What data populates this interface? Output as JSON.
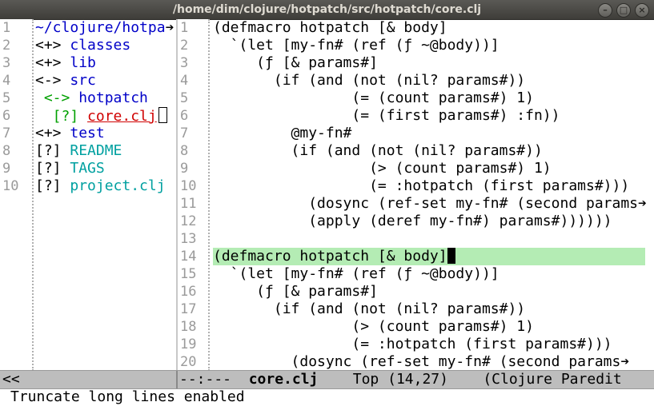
{
  "window": {
    "title": "/home/dim/clojure/hotpatch/src/hotpatch/core.clj",
    "buttons": [
      "–",
      "□",
      "×"
    ]
  },
  "tree_pane": {
    "line_numbers": [
      "1",
      "2",
      "3",
      "4",
      "5",
      "6",
      "7",
      "8",
      "9",
      "10"
    ],
    "lines": [
      {
        "text": "~/clojure/hotpa",
        "color": "#0000c8"
      },
      {
        "text": "<+> classes",
        "color": "#0000c8"
      },
      {
        "text": "<+> lib",
        "color": "#0000c8"
      },
      {
        "text": "<-> src",
        "color": "#0000c8"
      },
      {
        "text": " <-> hotpatch",
        "color": "#0000c8"
      },
      {
        "text": "  [?] core.clj",
        "color": "#d00000"
      },
      {
        "text": "<+> test",
        "color": "#0000c8"
      },
      {
        "text": "[?] README",
        "color": "#00a0a0"
      },
      {
        "text": "[?] TAGS",
        "color": "#00a0a0"
      },
      {
        "text": "[?] project.clj",
        "color": "#00a0a0"
      }
    ],
    "truncation_mark": "➔"
  },
  "code_pane": {
    "line_numbers": [
      "1",
      "2",
      "3",
      "4",
      "5",
      "6",
      "7",
      "8",
      "9",
      "10",
      "11",
      "12",
      "13",
      "14",
      "15",
      "16",
      "17",
      "18",
      "19",
      "20"
    ],
    "lines": [
      "(defmacro hotpatch [& body]",
      "  `(let [my-fn# (ref (ƒ ~@body))]",
      "     (ƒ [& params#]",
      "       (if (and (not (nil? params#))",
      "                (= (count params#) 1)",
      "                (= (first params#) :fn))",
      "         @my-fn#",
      "         (if (and (not (nil? params#))",
      "                  (> (count params#) 1)",
      "                  (= :hotpatch (first params#)))",
      "           (dosync (ref-set my-fn# (second params",
      "           (apply (deref my-fn#) params#))))))",
      "",
      "(defmacro hotpatch [& body]",
      "  `(let [my-fn# (ref (ƒ ~@body))]",
      "     (ƒ [& params#]",
      "       (if (and (not (nil? params#))",
      "                (> (count params#) 1)",
      "                (= :hotpatch (first params#)))",
      "         (dosync (ref-set my-fn# (second params"
    ],
    "current_line": "14"
  },
  "modeline": {
    "left": "<<",
    "status": "--:---  ",
    "buffer": "core.clj",
    "position": "    Top (14,27)    ",
    "mode": "(Clojure Paredit"
  },
  "echo_area": "Truncate long lines enabled"
}
